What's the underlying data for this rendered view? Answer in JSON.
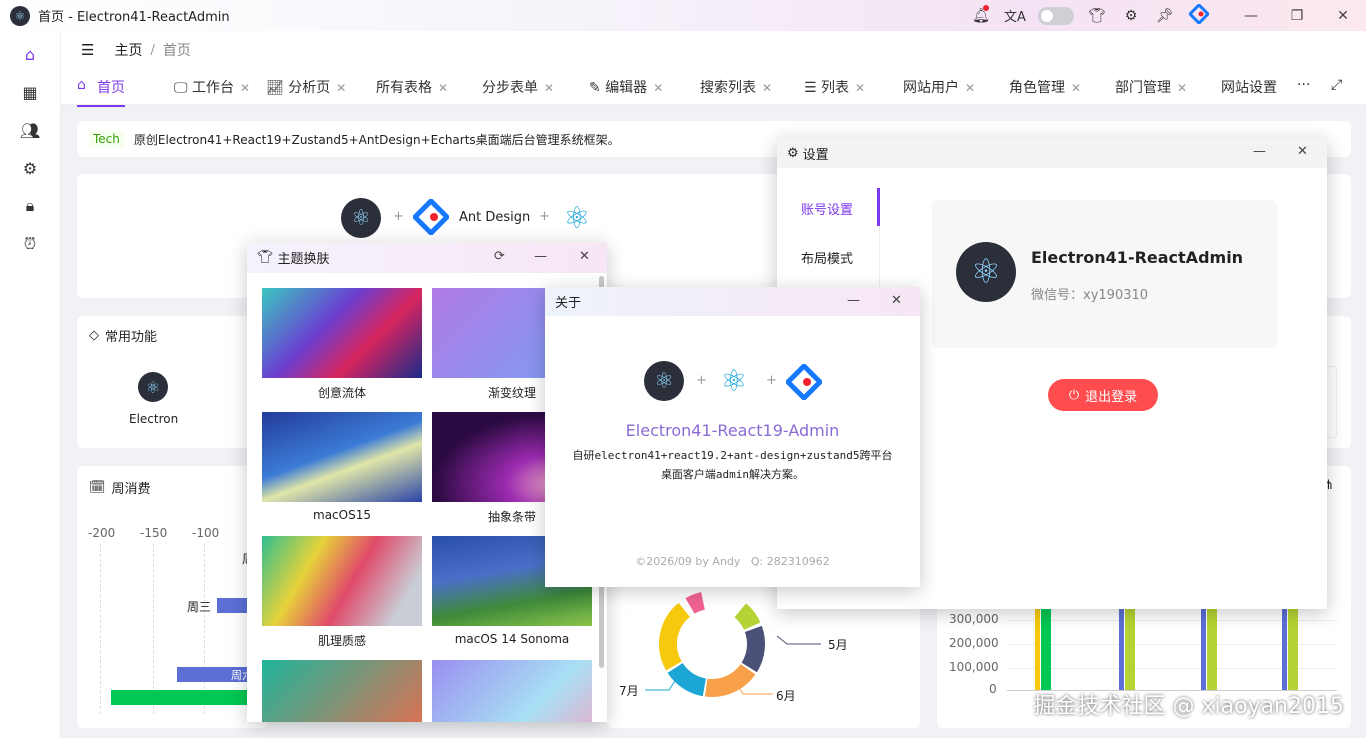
{
  "window": {
    "title": "首页 - Electron41-ReactAdmin"
  },
  "header": {
    "breadcrumb_home": "主页",
    "breadcrumb_sep": "/",
    "breadcrumb_current": "首页"
  },
  "tabs": [
    {
      "label": "首页",
      "closable": false
    },
    {
      "label": "工作台",
      "closable": true
    },
    {
      "label": "分析页",
      "closable": true
    },
    {
      "label": "所有表格",
      "closable": true
    },
    {
      "label": "分步表单",
      "closable": true
    },
    {
      "label": "编辑器",
      "closable": true
    },
    {
      "label": "搜索列表",
      "closable": true
    },
    {
      "label": "列表",
      "closable": true
    },
    {
      "label": "网站用户",
      "closable": true
    },
    {
      "label": "角色管理",
      "closable": true
    },
    {
      "label": "部门管理",
      "closable": true
    },
    {
      "label": "网站设置",
      "closable": false
    }
  ],
  "tab_more": "···",
  "notice": {
    "tag": "Tech",
    "text": "原创Electron41+React19+Zustand5+AntDesign+Echarts桌面端后台管理系统框架。"
  },
  "hero": {
    "plus": "+",
    "ant_label": "Ant Design"
  },
  "common": {
    "title": "常用功能",
    "item_label": "Electron"
  },
  "weekly": {
    "title": "周消费",
    "ticks": [
      "-200",
      "-150",
      "-100"
    ],
    "labels": [
      "周三",
      "周六"
    ],
    "label_cut": "周"
  },
  "donut": {
    "labels": [
      "5月",
      "6月",
      "7月"
    ]
  },
  "bars": {
    "y_ticks": [
      "300,000",
      "200,000",
      "100,000",
      "0"
    ]
  },
  "settings": {
    "title": "设置",
    "menu": [
      "账号设置",
      "布局模式"
    ],
    "app_name": "Electron41-ReactAdmin",
    "wechat_label": "微信号：",
    "wechat_id": "xy190310",
    "logout": "退出登录",
    "accent": "#ff4d4f"
  },
  "theme": {
    "title": "主题换肤",
    "items": [
      {
        "caption": "创意流体"
      },
      {
        "caption": "渐变纹理"
      },
      {
        "caption": "macOS15"
      },
      {
        "caption": "抽象条带"
      },
      {
        "caption": "肌理质感"
      },
      {
        "caption": "macOS 14 Sonoma"
      }
    ]
  },
  "about": {
    "title": "关于",
    "name": "Electron41-React19-Admin",
    "desc1": "自研electron41+react19.2+ant-design+zustand5跨平台",
    "desc2": "桌面客户端admin解决方案。",
    "footer": "©2026/09 by Andy   Q: 282310962",
    "plus": "+"
  },
  "watermark": "掘金技术社区 @ xiaoyan2015",
  "colors": {
    "primary": "#7c3aed",
    "danger": "#ff4d4f",
    "bar_green": "#00c853",
    "bar_blue": "#5b6fd6",
    "bar_lime": "#b5d334"
  },
  "icons": [
    "home-icon",
    "apps-icon",
    "users-icon",
    "gear-icon",
    "lock-icon",
    "alarm-icon",
    "bell-icon",
    "translate-icon",
    "shirt-icon",
    "pin-icon",
    "ant-logo-icon",
    "menu-fold-icon",
    "expand-icon"
  ]
}
